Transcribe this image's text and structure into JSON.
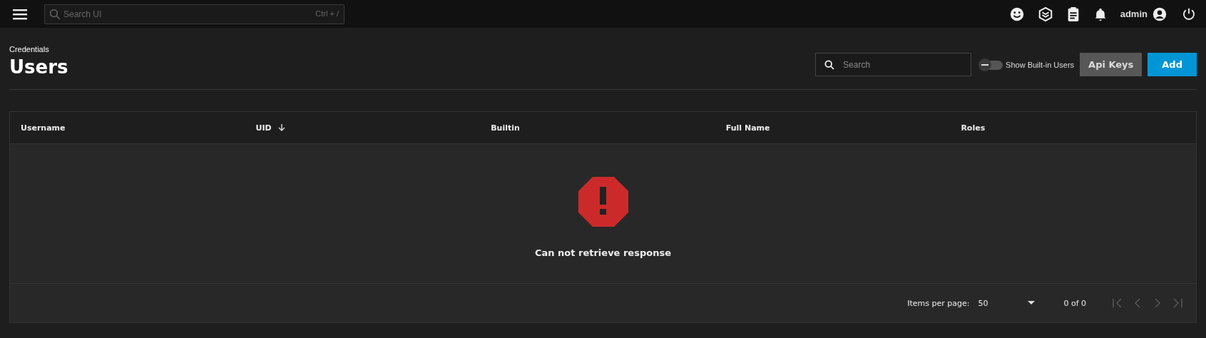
{
  "topbar": {
    "search": {
      "placeholder": "Search UI",
      "shortcut": "Ctrl + /"
    },
    "user": "admin"
  },
  "breadcrumb": "Credentials",
  "title": "Users",
  "toolbar": {
    "search": {
      "placeholder": "Search"
    },
    "toggle": {
      "label": "Show Built-in Users",
      "on": false
    },
    "buttons": [
      {
        "label": "Api Keys",
        "kind": "secondary"
      },
      {
        "label": "Add",
        "kind": "primary"
      }
    ]
  },
  "table": {
    "columns": [
      {
        "label": "Username",
        "sorted": false
      },
      {
        "label": "UID",
        "sorted": true
      },
      {
        "label": "Builtin",
        "sorted": false
      },
      {
        "label": "Full Name",
        "sorted": false
      },
      {
        "label": "Roles",
        "sorted": false
      }
    ],
    "empty_message": "Can not retrieve response"
  },
  "paginator": {
    "label": "Items per page:",
    "page_size": "50",
    "range": "0 of 0",
    "disabled": true
  }
}
